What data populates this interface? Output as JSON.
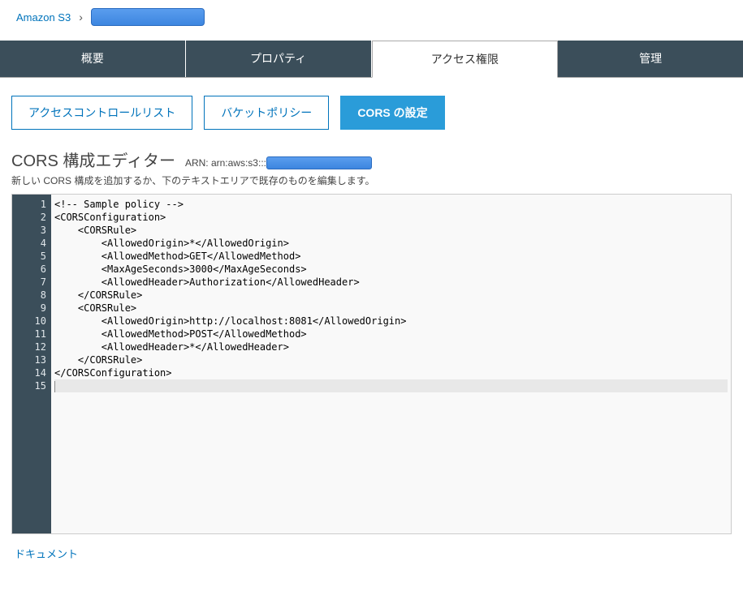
{
  "breadcrumb": {
    "root": "Amazon S3"
  },
  "tabs": {
    "main": [
      {
        "label": "概要",
        "active": false
      },
      {
        "label": "プロパティ",
        "active": false
      },
      {
        "label": "アクセス権限",
        "active": true
      },
      {
        "label": "管理",
        "active": false
      }
    ],
    "sub": [
      {
        "label": "アクセスコントロールリスト",
        "active": false
      },
      {
        "label": "バケットポリシー",
        "active": false
      },
      {
        "label": "CORS の設定",
        "active": true
      }
    ]
  },
  "editor": {
    "title": "CORS 構成エディター",
    "arn_label": "ARN: arn:aws:s3:::",
    "subtitle": "新しい CORS 構成を追加するか、下のテキストエリアで既存のものを編集します。",
    "line_count": 15,
    "code_lines": [
      "<!-- Sample policy -->",
      "<CORSConfiguration>",
      "    <CORSRule>",
      "        <AllowedOrigin>*</AllowedOrigin>",
      "        <AllowedMethod>GET</AllowedMethod>",
      "        <MaxAgeSeconds>3000</MaxAgeSeconds>",
      "        <AllowedHeader>Authorization</AllowedHeader>",
      "    </CORSRule>",
      "    <CORSRule>",
      "        <AllowedOrigin>http://localhost:8081</AllowedOrigin>",
      "        <AllowedMethod>POST</AllowedMethod>",
      "        <AllowedHeader>*</AllowedHeader>",
      "    </CORSRule>",
      "</CORSConfiguration>",
      ""
    ]
  },
  "footer": {
    "doc_link": "ドキュメント"
  }
}
